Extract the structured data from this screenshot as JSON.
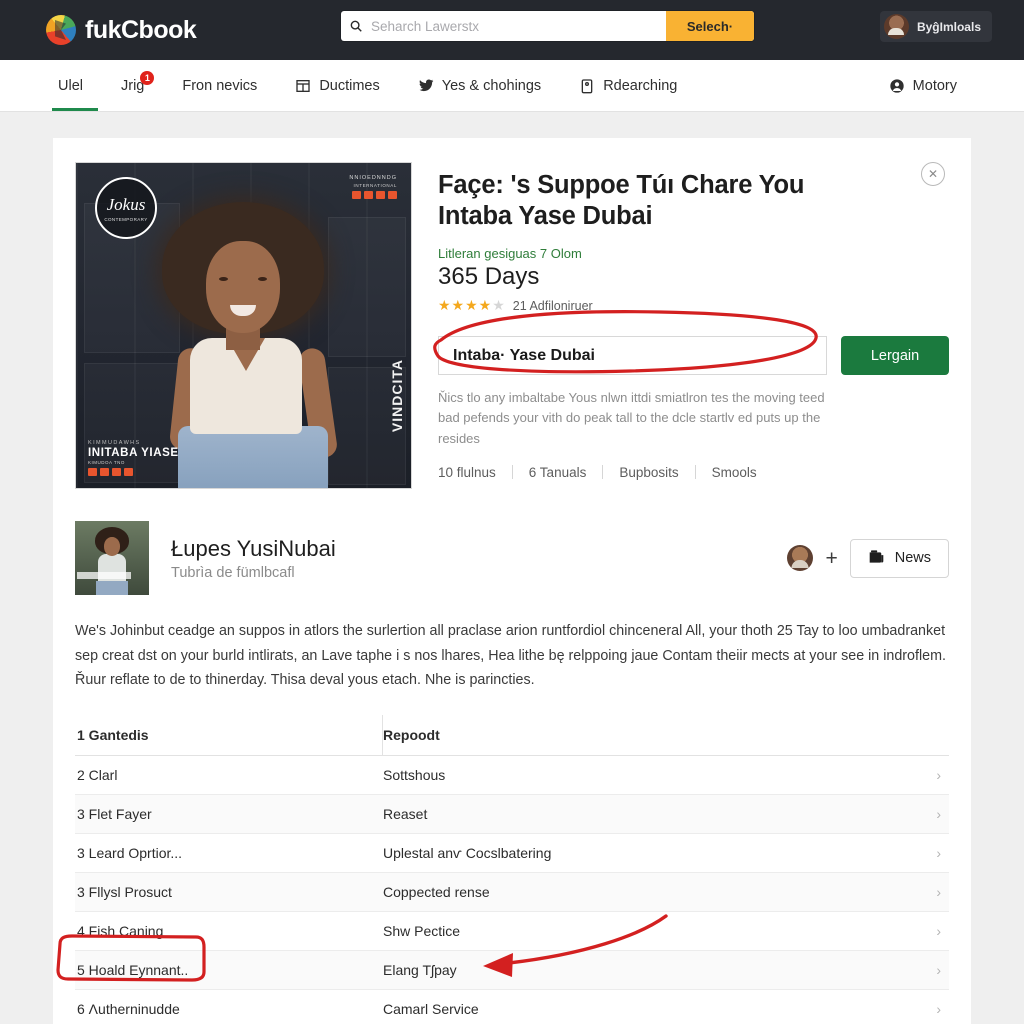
{
  "topbar": {
    "brand": "fukCbook",
    "brand_icon": "colorful-circle-logo",
    "search": {
      "placeholder": "Seharch Lawerstx",
      "value": "",
      "icon": "search-icon",
      "button_label": "Selech·"
    },
    "user": {
      "name": "ByĝImloals",
      "avatar": "user-avatar"
    }
  },
  "nav": {
    "items": [
      {
        "label": "Ulel",
        "icon": null,
        "active": true,
        "badge": null
      },
      {
        "label": "Jrig",
        "icon": null,
        "active": false,
        "badge": "1"
      },
      {
        "label": "Fron nevics",
        "icon": null,
        "active": false,
        "badge": null
      },
      {
        "label": "Ductimes",
        "icon": "window-icon",
        "active": false,
        "badge": null
      },
      {
        "label": "Yes & chohings",
        "icon": "bird-icon",
        "active": false,
        "badge": null
      },
      {
        "label": "Rdearching",
        "icon": "clipboard-icon",
        "active": false,
        "badge": null
      }
    ],
    "right_item": {
      "label": "Motory",
      "icon": "person-icon"
    }
  },
  "hero": {
    "photo": {
      "alt": "smiling-woman-portrait",
      "badge_line1": "Jokus",
      "badge_line2": "CONTEMPORARY",
      "overlay_top_line1": "NNIOEDNNDG",
      "overlay_top_line2": "INTERNATIONAL",
      "overlay_bottom_kicker": "KIMMUDAWHS",
      "overlay_bottom_title": "INITABA YIASE",
      "overlay_bottom_sub": "KIMUDOA TNO",
      "vertical_text": "VINDCITA",
      "chip_count": 4
    },
    "close_icon": "close-icon",
    "title": "Façe: 's Suppoe Túı Chare You Intaba Yase Dubai",
    "subtitle": "Litleran gesiguas 7 Olom",
    "days": "365 Days",
    "stars_filled": 4,
    "stars_total": 5,
    "rating_count": "21 Adfiloniruer",
    "name_field_value": "Intaba· Yase Dubai",
    "cta_label": "Lergain",
    "description": "Ňics tlo any imbaltabe Yous nlwn ittdi smiatlron tes the moving teed bad pefends your vith do peak tall to the dcle startlv ed puts up the resides",
    "meta": [
      "10 flulnus",
      "6 Tanuals",
      "Bupbosits",
      "Smools"
    ]
  },
  "profile": {
    "thumb": "profile-thumbnail",
    "name": "Łupes YusiNubai",
    "subtitle": "Tubrìa de fümlbcafl",
    "avatar": "follower-avatar",
    "plus_label": "+",
    "news_button": {
      "label": "News",
      "icon": "news-icon"
    }
  },
  "body_copy": "We's Johinbut ceadge an suppos in atlors the surlertion all praclase arion runtfordiol chinceneral All, your thoth 25 Tay to loo umbadranket sep creat dst on your burld intlirats, an Lave taphe i s nos lhares, Hea lithe bę relppoing jaue Contam theiir mects at your see in indroflem. Řuur reflate to de to thinerday. Thisa deval yous etach. Nhe is parincties.",
  "table": {
    "header": {
      "col1": "1 Gantedis",
      "col2": "Repoodt"
    },
    "rows": [
      {
        "col1": "2 Clarl",
        "col2": "Sottshous",
        "chevron": "›"
      },
      {
        "col1": "3 Flet Fayer",
        "col2": "Reaset",
        "chevron": "›"
      },
      {
        "col1": "3 Leard Oprtior...",
        "col2": "Uplestal anѵ Cocslbatering",
        "chevron": "›"
      },
      {
        "col1": "3 Fllysl Prosuct",
        "col2": "Coppected rense",
        "chevron": "›"
      },
      {
        "col1": "4 Fish Caning",
        "col2": "Shw Pectice",
        "chevron": "›"
      },
      {
        "col1": "5 Hoald Eynnant..",
        "col2": "Elang Tʃpay",
        "chevron": "›"
      },
      {
        "col1": "6 Ʌutherninudde",
        "col2": "Camarl Service",
        "chevron": "›"
      }
    ]
  },
  "annotations": {
    "color": "#d32020",
    "ellipse_target": "name-field",
    "rect_target": "table-row-5-col1",
    "arrow_target": "table-row-5-col2"
  },
  "colors": {
    "topbar_bg": "#25282e",
    "accent_green": "#1b7a3e",
    "accent_yellow": "#f9b233",
    "badge_red": "#e0231b",
    "page_bg": "#efefef",
    "star": "#f4a81d"
  }
}
